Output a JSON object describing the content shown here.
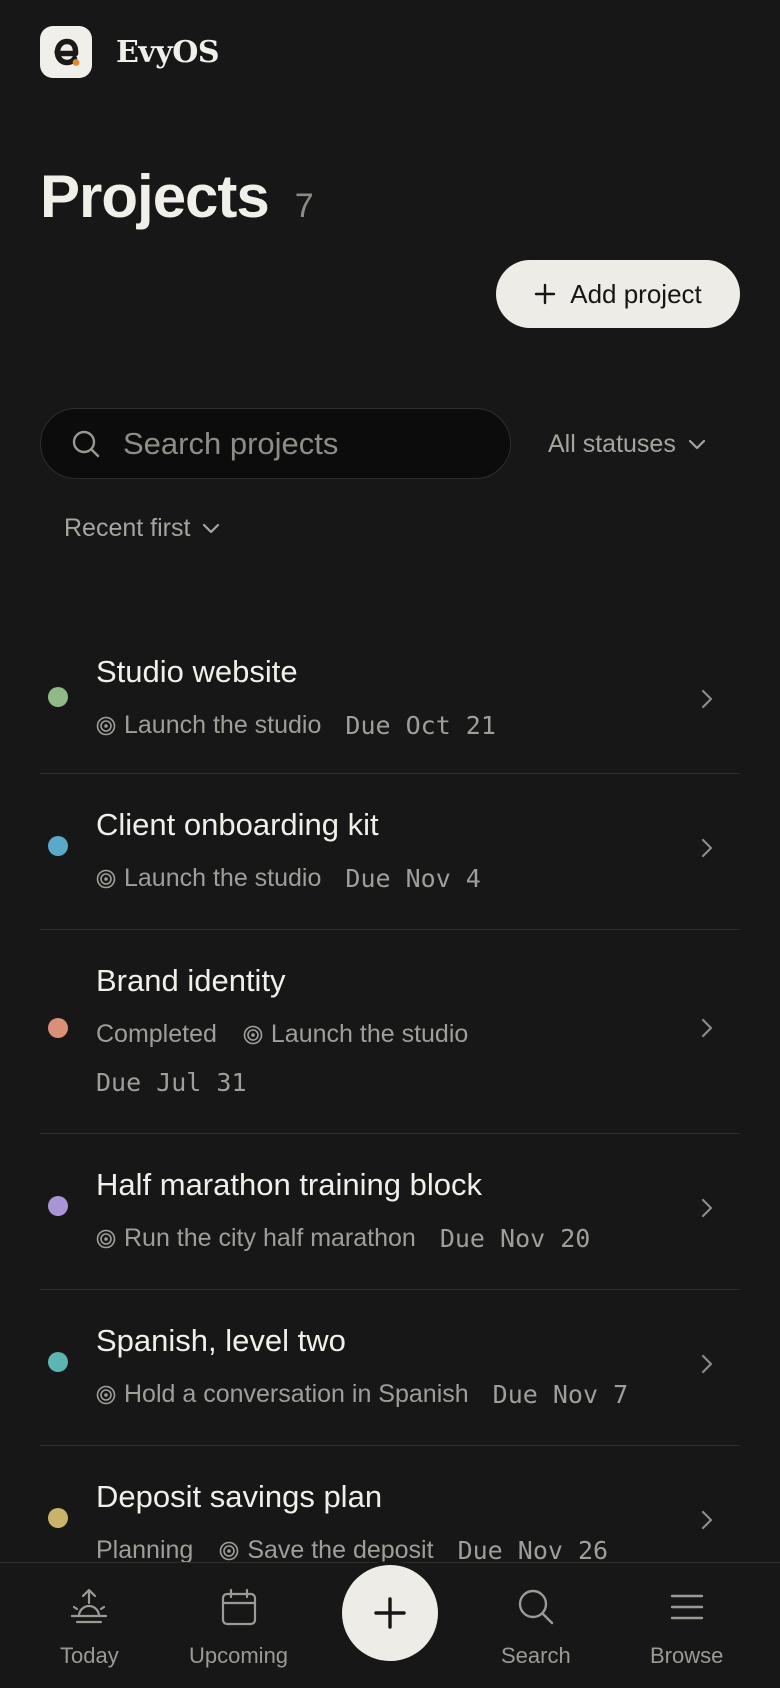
{
  "app": {
    "name": "EvyOS"
  },
  "header": {
    "title": "Projects",
    "count": "7"
  },
  "actions": {
    "add_project_label": "Add project"
  },
  "search": {
    "placeholder": "Search projects",
    "value": ""
  },
  "filters": {
    "status_label": "All statuses",
    "sort_label": "Recent first"
  },
  "projects": [
    {
      "name": "Studio website",
      "status": "",
      "goal": "Launch the studio",
      "due": "Due Oct 21",
      "color": "#8fba85"
    },
    {
      "name": "Client onboarding kit",
      "status": "",
      "goal": "Launch the studio",
      "due": "Due Nov 4",
      "color": "#5aa9c9"
    },
    {
      "name": "Brand identity",
      "status": "Completed",
      "goal": "Launch the studio",
      "due": "Due Jul 31",
      "color": "#d98f78"
    },
    {
      "name": "Half marathon training block",
      "status": "",
      "goal": "Run the city half marathon",
      "due": "Due Nov 20",
      "color": "#a995d6"
    },
    {
      "name": "Spanish, level two",
      "status": "",
      "goal": "Hold a conversation in Spanish",
      "due": "Due Nov 7",
      "color": "#5bb5b1"
    },
    {
      "name": "Deposit savings plan",
      "status": "Planning",
      "goal": "Save the deposit",
      "due": "Due Nov 26",
      "color": "#c9b36a"
    }
  ],
  "nav": {
    "items": [
      {
        "label": "Today",
        "icon": "sunrise-icon"
      },
      {
        "label": "Upcoming",
        "icon": "calendar-icon"
      },
      {
        "label": "Search",
        "icon": "search-icon"
      },
      {
        "label": "Browse",
        "icon": "menu-icon"
      }
    ],
    "fab_icon": "plus-icon"
  },
  "colors": {
    "background": "#171717",
    "accent": "#eeece6",
    "logo_dot": "#e08a2c"
  }
}
